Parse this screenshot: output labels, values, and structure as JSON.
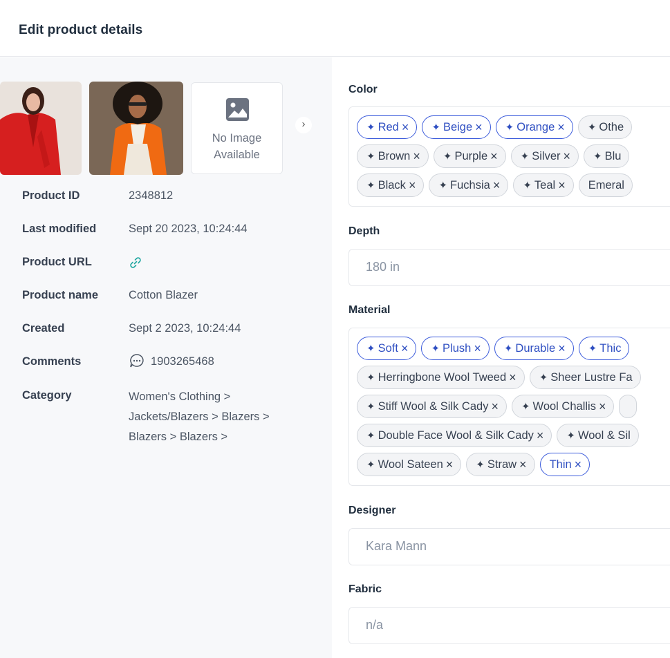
{
  "header": {
    "title": "Edit product details"
  },
  "gallery": {
    "no_image_line1": "No Image",
    "no_image_line2": "Available",
    "next_label": "›"
  },
  "details": [
    {
      "label": "Product ID",
      "value": "2348812"
    },
    {
      "label": "Last modified",
      "value": "Sept 20 2023, 10:24:44"
    },
    {
      "label": "Product URL",
      "value": ""
    },
    {
      "label": "Product name",
      "value": "Cotton Blazer"
    },
    {
      "label": "Created",
      "value": "Sept 2 2023, 10:24:44"
    },
    {
      "label": "Comments",
      "value": "1903265468"
    },
    {
      "label": "Category",
      "value_lines": [
        "Women's Clothing >",
        "Jackets/Blazers > Blazers >",
        "Blazers > Blazers >"
      ]
    }
  ],
  "fields": {
    "color": {
      "label": "Color",
      "rows": [
        [
          {
            "text": "Red",
            "ai": true,
            "selected": true
          },
          {
            "text": "Beige",
            "ai": true,
            "selected": true
          },
          {
            "text": "Orange",
            "ai": true,
            "selected": true
          },
          {
            "text": "Othe",
            "ai": true,
            "selected": false
          }
        ],
        [
          {
            "text": "Brown",
            "ai": true,
            "selected": false
          },
          {
            "text": "Purple",
            "ai": true,
            "selected": false
          },
          {
            "text": "Silver",
            "ai": true,
            "selected": false
          },
          {
            "text": "Blu",
            "ai": true,
            "selected": false
          }
        ],
        [
          {
            "text": "Black",
            "ai": true,
            "selected": false
          },
          {
            "text": "Fuchsia",
            "ai": true,
            "selected": false
          },
          {
            "text": "Teal",
            "ai": true,
            "selected": false
          },
          {
            "text": "Emeral",
            "ai": false,
            "selected": false
          }
        ]
      ]
    },
    "depth": {
      "label": "Depth",
      "value": "180 in"
    },
    "material": {
      "label": "Material",
      "rows": [
        [
          {
            "text": "Soft",
            "ai": true,
            "selected": true
          },
          {
            "text": "Plush",
            "ai": true,
            "selected": true
          },
          {
            "text": "Durable",
            "ai": true,
            "selected": true
          },
          {
            "text": "Thic",
            "ai": true,
            "selected": true
          }
        ],
        [
          {
            "text": "Herringbone Wool Tweed",
            "ai": true,
            "selected": false
          },
          {
            "text": "Sheer Lustre Fa",
            "ai": true,
            "selected": false
          }
        ],
        [
          {
            "text": "Stiff Wool & Silk Cady",
            "ai": true,
            "selected": false
          },
          {
            "text": "Wool Challis",
            "ai": true,
            "selected": false
          },
          {
            "text": "",
            "ai": false,
            "selected": false
          }
        ],
        [
          {
            "text": "Double Face Wool & Silk Cady",
            "ai": true,
            "selected": false
          },
          {
            "text": "Wool & Sil",
            "ai": true,
            "selected": false
          }
        ],
        [
          {
            "text": "Wool Sateen",
            "ai": true,
            "selected": false
          },
          {
            "text": "Straw",
            "ai": true,
            "selected": false
          },
          {
            "text": "Thin",
            "ai": false,
            "selected": true
          }
        ]
      ]
    },
    "designer": {
      "label": "Designer",
      "value": "Kara Mann"
    },
    "fabric": {
      "label": "Fabric",
      "value": "n/a"
    }
  },
  "colors": {
    "accent": "#3b5bdb",
    "link": "#20a7a0",
    "panel": "#f7f8fa"
  }
}
